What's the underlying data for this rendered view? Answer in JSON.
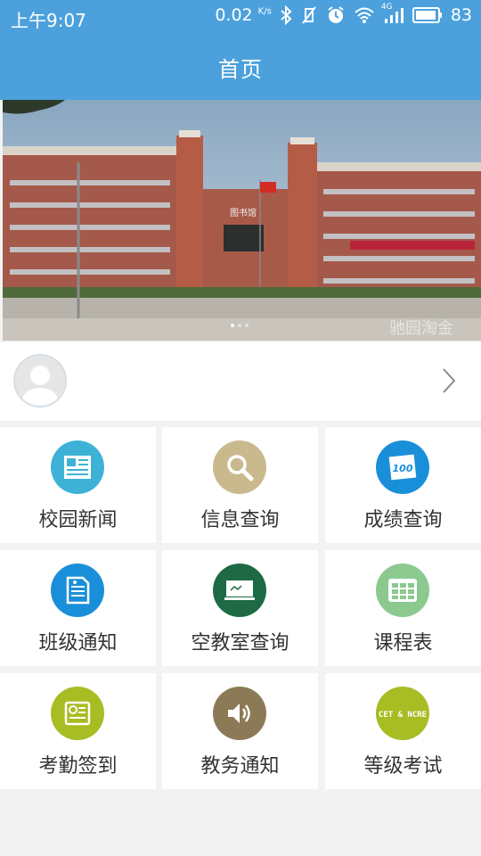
{
  "status_bar": {
    "time": "上午9:07",
    "net_speed": "0.02",
    "net_unit": "K/s",
    "network_type": "4G",
    "battery": "83"
  },
  "header": {
    "title": "首页"
  },
  "banner": {
    "building_sign": "图书馆",
    "watermark": "驰园淘金"
  },
  "profile": {
    "avatar_icon": "person-silhouette-icon",
    "chevron_icon": "chevron-right-icon"
  },
  "menu": {
    "items": [
      {
        "label": "校园新闻",
        "icon": "news-icon",
        "color": "#3eb2d6"
      },
      {
        "label": "信息查询",
        "icon": "search-icon",
        "color": "#c9b98d"
      },
      {
        "label": "成绩查询",
        "icon": "score-100-icon",
        "color": "#1a8fd9"
      },
      {
        "label": "班级通知",
        "icon": "notice-document-icon",
        "color": "#1a8fd9"
      },
      {
        "label": "空教室查询",
        "icon": "blackboard-icon",
        "color": "#1d6a45"
      },
      {
        "label": "课程表",
        "icon": "timetable-grid-icon",
        "color": "#8bc98f"
      },
      {
        "label": "考勤签到",
        "icon": "attendance-checkin-icon",
        "color": "#a8bc23"
      },
      {
        "label": "教务通知",
        "icon": "speaker-icon",
        "color": "#8c7a57"
      },
      {
        "label": "等级考试",
        "icon": "cet-ncre-icon",
        "color": "#a8bc23",
        "badge_text": "CET & NCRE"
      }
    ]
  }
}
